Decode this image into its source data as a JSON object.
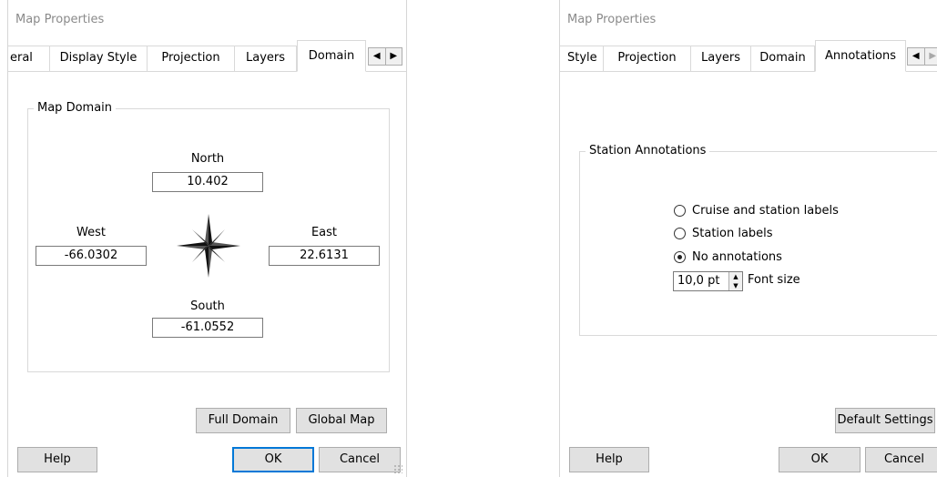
{
  "dialog1": {
    "title": "Map Properties",
    "tabs": [
      "eral",
      "Display Style",
      "Projection",
      "Layers",
      "Domain"
    ],
    "active_tab": "Domain",
    "group_title": "Map Domain",
    "north": {
      "label": "North",
      "value": "10.402"
    },
    "west": {
      "label": "West",
      "value": "-66.0302"
    },
    "east": {
      "label": "East",
      "value": "22.6131"
    },
    "south": {
      "label": "South",
      "value": "-61.0552"
    },
    "full_domain_label": "Full Domain",
    "global_map_label": "Global Map",
    "help_label": "Help",
    "ok_label": "OK",
    "cancel_label": "Cancel"
  },
  "dialog2": {
    "title": "Map Properties",
    "tabs": [
      "Style",
      "Projection",
      "Layers",
      "Domain",
      "Annotations"
    ],
    "active_tab": "Annotations",
    "group_title": "Station Annotations",
    "radios": [
      {
        "label": "Cruise and station labels",
        "checked": false
      },
      {
        "label": "Station labels",
        "checked": false
      },
      {
        "label": "No annotations",
        "checked": true
      }
    ],
    "font_size_value": "10,0 pt",
    "font_size_label": "Font size",
    "default_settings_label": "Default Settings",
    "help_label": "Help",
    "ok_label": "OK",
    "cancel_label": "Cancel"
  },
  "icons": {
    "tab_left": "◀",
    "tab_right": "▶",
    "spin_up": "▲",
    "spin_down": "▼"
  }
}
